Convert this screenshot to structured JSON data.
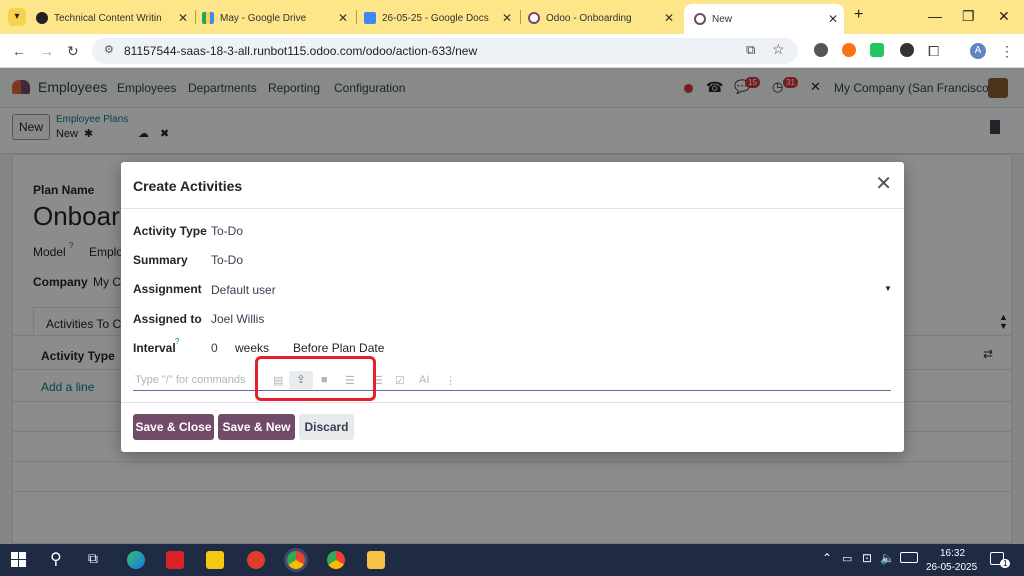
{
  "browser": {
    "tabs": [
      {
        "title": "Technical Content Writin",
        "active": false
      },
      {
        "title": "May - Google Drive",
        "active": false
      },
      {
        "title": "26-05-25 - Google Docs",
        "active": false
      },
      {
        "title": "Odoo - Onboarding",
        "active": false
      },
      {
        "title": "New",
        "active": true
      }
    ],
    "new_tab": "+",
    "url": "81157544-saas-18-3-all.runbot115.odoo.com/odoo/action-633/new",
    "profile_initial": "A"
  },
  "odoo_nav": {
    "app_name": "Employees",
    "menu": [
      "Employees",
      "Departments",
      "Reporting",
      "Configuration"
    ],
    "messages_count": "15",
    "activities_count": "31",
    "company": "My Company (San Francisco)"
  },
  "control_panel": {
    "new_button": "New",
    "breadcrumb_parent": "Employee Plans",
    "breadcrumb_current": "New"
  },
  "background_form": {
    "plan_name_label": "Plan Name",
    "plan_name_value": "Onboar",
    "model_label": "Model",
    "model_help": "?",
    "model_value": "Emplo",
    "company_label": "Company",
    "company_value": "My C",
    "tab_label": "Activities To Cr",
    "col_activity_type": "Activity Type",
    "add_line": "Add a line"
  },
  "modal": {
    "title": "Create Activities",
    "fields": {
      "activity_type_label": "Activity Type",
      "activity_type_value": "To-Do",
      "summary_label": "Summary",
      "summary_value": "To-Do",
      "assignment_label": "Assignment",
      "assignment_value": "Default user",
      "assigned_to_label": "Assigned to",
      "assigned_to_value": "Joel Willis",
      "interval_label": "Interval",
      "interval_help": "?",
      "interval_value": "0",
      "interval_unit": "weeks",
      "interval_trigger": "Before Plan Date"
    },
    "editor_placeholder": "Type \"/\" for commands",
    "editor_ai": "AI",
    "buttons": {
      "save_close": "Save & Close",
      "save_new": "Save & New",
      "discard": "Discard"
    }
  },
  "taskbar": {
    "time": "16:32",
    "date": "26-05-2025",
    "notif_count": "1"
  }
}
